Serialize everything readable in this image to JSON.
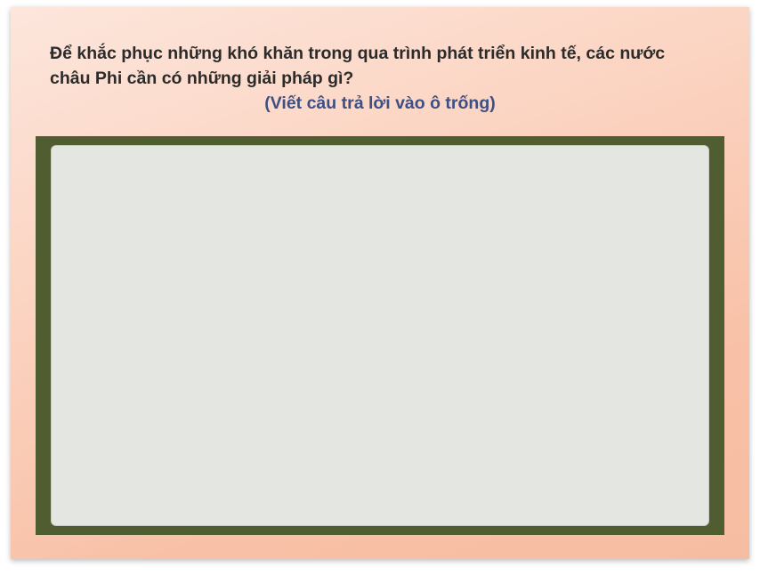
{
  "question": {
    "text": "Để khắc phục những khó khăn trong qua trình phát triển kinh tế, các nước châu Phi cần có những giải pháp gì?",
    "instruction": "(Viết câu trả lời vào ô trống)"
  },
  "answer_box": {
    "value": "",
    "placeholder": ""
  },
  "colors": {
    "frame": "#4f5d31",
    "answer_background": "#e4e6e1",
    "instruction_text": "#3e4f84",
    "card_gradient_start": "#fde6dc",
    "card_gradient_end": "#f7bda2"
  }
}
